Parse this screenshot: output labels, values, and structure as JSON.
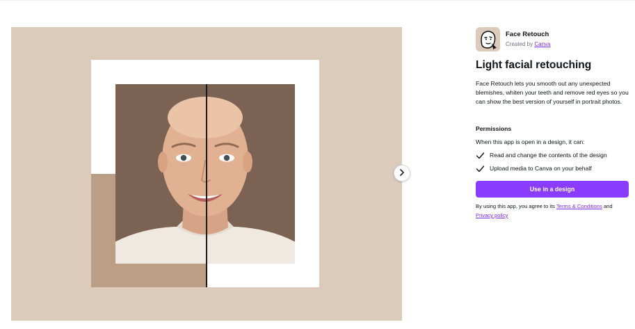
{
  "app": {
    "icon": "face-retouch-icon",
    "name": "Face Retouch",
    "created_by_prefix": "Created by",
    "creator": "Canva"
  },
  "headline": "Light facial retouching",
  "description": "Face Retouch lets you smooth out any unexpected blemishes, whiten your teeth and remove red eyes so you can show the best version of yourself in portrait photos.",
  "permissions": {
    "heading": "Permissions",
    "intro": "When this app is open in a design, it can:",
    "items": [
      {
        "icon": "check-icon",
        "label": "Read and change the contents of the design"
      },
      {
        "icon": "check-icon",
        "label": "Upload media to Canva on your behalf"
      }
    ]
  },
  "cta_label": "Use in a design",
  "terms": {
    "prefix": "By using this app, you agree to its",
    "terms_link": "Terms & Conditions",
    "conjunction": "and",
    "privacy_link": "Privacy policy"
  },
  "preview": {
    "next_icon": "chevron-right-icon",
    "background": "#dccbbb",
    "accent": "#bb9e85",
    "photo_background": "#7b6252"
  },
  "colors": {
    "brand_purple": "#8b3dff",
    "link_purple": "#7d2ae8",
    "text": "#0e1318"
  }
}
